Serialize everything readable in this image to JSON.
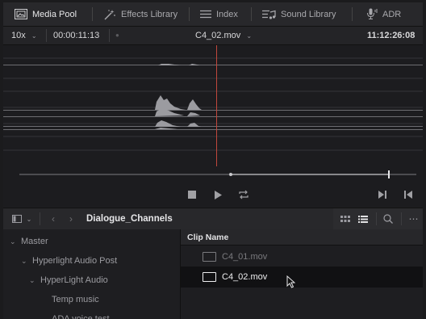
{
  "tabs": [
    {
      "label": "Media Pool",
      "icon": "media-pool-icon",
      "active": true
    },
    {
      "label": "Effects Library",
      "icon": "effects-wand-icon",
      "active": false
    },
    {
      "label": "Index",
      "icon": "index-list-icon",
      "active": false
    },
    {
      "label": "Sound Library",
      "icon": "sound-library-icon",
      "active": false
    },
    {
      "label": "ADR",
      "icon": "microphone-icon",
      "active": false
    }
  ],
  "viewer": {
    "zoom": "10x",
    "source_timecode": "00:00:11:13",
    "clip_name": "C4_02.mov",
    "record_timecode": "11:12:26:08"
  },
  "bin": {
    "title": "Dialogue_Channels"
  },
  "bins_tree": [
    {
      "label": "Master",
      "expanded": true,
      "level": 0
    },
    {
      "label": "Hyperlight Audio Post",
      "expanded": true,
      "level": 1
    },
    {
      "label": "HyperLight Audio",
      "expanded": true,
      "level": 2
    },
    {
      "label": "Temp music",
      "expanded": false,
      "level": 3
    },
    {
      "label": "ADA voice test",
      "expanded": false,
      "level": 3
    }
  ],
  "clip_list": {
    "column_header": "Clip Name",
    "rows": [
      {
        "name": "C4_01.mov",
        "selected": false
      },
      {
        "name": "C4_02.mov",
        "selected": true
      }
    ]
  },
  "colors": {
    "playhead": "#c0483d",
    "background": "#1e1e21",
    "waveform": "#9b9ba0"
  }
}
